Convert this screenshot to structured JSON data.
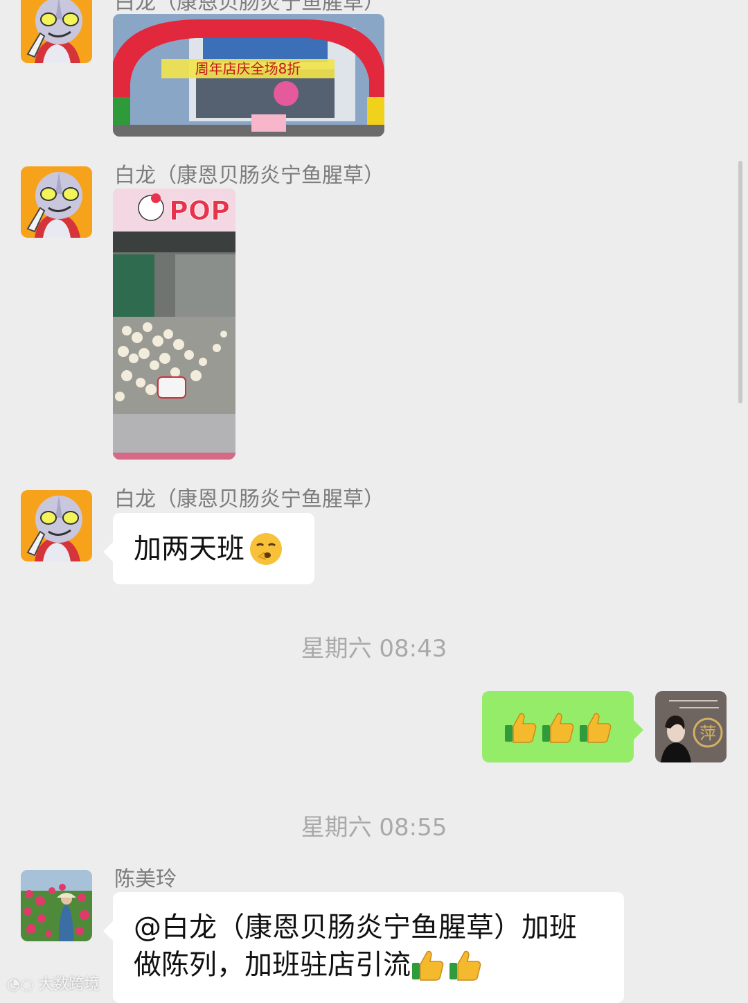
{
  "chat": {
    "messages": [
      {
        "sender": "白龙（康恩贝肠炎宁鱼腥草）",
        "type": "image",
        "content": "store anniversary photo",
        "banner_text": "周年店庆全场8折"
      },
      {
        "sender": "白龙（康恩贝肠炎宁鱼腥草）",
        "type": "image",
        "content": "popcorn machine photo",
        "banner_text": "POP"
      },
      {
        "sender": "白龙（康恩贝肠炎宁鱼腥草）",
        "type": "text",
        "text": "加两天班",
        "emoji": "hushed-face-emoji"
      },
      {
        "timestamp": "星期六 08:43"
      },
      {
        "sender": "self",
        "type": "text",
        "text": "",
        "emoji": "thumbs-up-emoji x3"
      },
      {
        "timestamp": "星期六 08:55"
      },
      {
        "sender": "陈美玲",
        "type": "text",
        "text_line1": "@白龙（康恩贝肠炎宁鱼腥草）加班",
        "text_line2": "做陈列，加班驻店引流",
        "emoji": "thumbs-up-emoji x2"
      }
    ],
    "self_avatar_char": "萍"
  },
  "watermark": "大数跨境",
  "colors": {
    "background": "#ededed",
    "bubble_self": "#95ec69",
    "bubble_other": "#ffffff"
  }
}
